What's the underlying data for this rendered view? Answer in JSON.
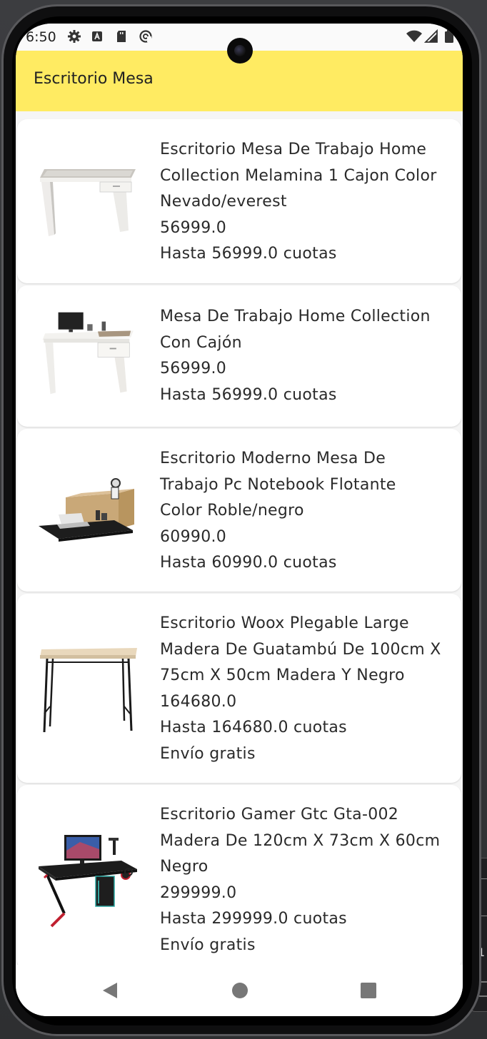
{
  "status_bar": {
    "time": "6:50",
    "left_icons": [
      "settings-icon",
      "a-badge-icon",
      "sd-card-icon",
      "sync-icon"
    ],
    "right_icons": [
      "wifi-icon",
      "signal-icon",
      "battery-icon"
    ]
  },
  "app_bar": {
    "title": "Escritorio Mesa",
    "color": "#ffeb62"
  },
  "products": [
    {
      "title_lines": [
        "Escritorio Mesa De Trabajo Home",
        "Collection Melamina 1 Cajon Color",
        "Nevado/everest"
      ],
      "price": "56999.0",
      "installments": "Hasta 56999.0 cuotas",
      "shipping": ""
    },
    {
      "title_lines": [
        "Mesa De Trabajo Home Collection",
        "Con Cajón"
      ],
      "price": "56999.0",
      "installments": "Hasta 56999.0 cuotas",
      "shipping": ""
    },
    {
      "title_lines": [
        "Escritorio Moderno Mesa De",
        "Trabajo Pc Notebook Flotante",
        "Color Roble/negro"
      ],
      "price": "60990.0",
      "installments": "Hasta 60990.0 cuotas",
      "shipping": ""
    },
    {
      "title_lines": [
        "Escritorio Woox  Plegable Large",
        "Madera De Guatambú De 100cm X",
        "75cm X 50cm Madera Y Negro"
      ],
      "price": "164680.0",
      "installments": "Hasta 164680.0 cuotas",
      "shipping": "Envío gratis"
    },
    {
      "title_lines": [
        "Escritorio Gamer Gtc Gta-002",
        "Madera De 120cm X 73cm X 60cm",
        "Negro"
      ],
      "price": "299999.0",
      "installments": "Hasta 299999.0 cuotas",
      "shipping": "Envío gratis"
    }
  ],
  "nav_bar": {
    "icons": [
      "back-icon",
      "home-icon",
      "recents-icon"
    ]
  },
  "side_panel": {
    "digit": "1"
  }
}
